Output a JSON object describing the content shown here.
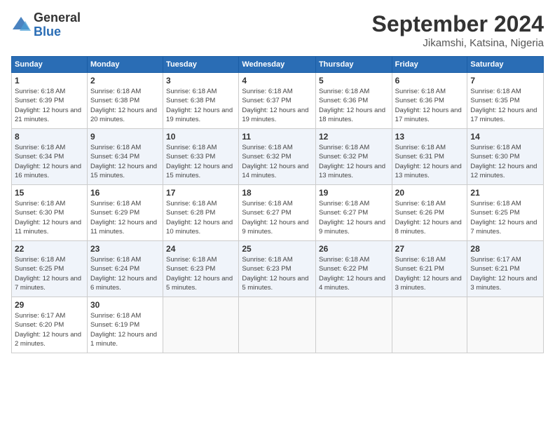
{
  "logo": {
    "general": "General",
    "blue": "Blue"
  },
  "title": "September 2024",
  "location": "Jikamshi, Katsina, Nigeria",
  "headers": [
    "Sunday",
    "Monday",
    "Tuesday",
    "Wednesday",
    "Thursday",
    "Friday",
    "Saturday"
  ],
  "weeks": [
    [
      {
        "day": "1",
        "sunrise": "6:18 AM",
        "sunset": "6:39 PM",
        "daylight": "12 hours and 21 minutes."
      },
      {
        "day": "2",
        "sunrise": "6:18 AM",
        "sunset": "6:38 PM",
        "daylight": "12 hours and 20 minutes."
      },
      {
        "day": "3",
        "sunrise": "6:18 AM",
        "sunset": "6:38 PM",
        "daylight": "12 hours and 19 minutes."
      },
      {
        "day": "4",
        "sunrise": "6:18 AM",
        "sunset": "6:37 PM",
        "daylight": "12 hours and 19 minutes."
      },
      {
        "day": "5",
        "sunrise": "6:18 AM",
        "sunset": "6:36 PM",
        "daylight": "12 hours and 18 minutes."
      },
      {
        "day": "6",
        "sunrise": "6:18 AM",
        "sunset": "6:36 PM",
        "daylight": "12 hours and 17 minutes."
      },
      {
        "day": "7",
        "sunrise": "6:18 AM",
        "sunset": "6:35 PM",
        "daylight": "12 hours and 17 minutes."
      }
    ],
    [
      {
        "day": "8",
        "sunrise": "6:18 AM",
        "sunset": "6:34 PM",
        "daylight": "12 hours and 16 minutes."
      },
      {
        "day": "9",
        "sunrise": "6:18 AM",
        "sunset": "6:34 PM",
        "daylight": "12 hours and 15 minutes."
      },
      {
        "day": "10",
        "sunrise": "6:18 AM",
        "sunset": "6:33 PM",
        "daylight": "12 hours and 15 minutes."
      },
      {
        "day": "11",
        "sunrise": "6:18 AM",
        "sunset": "6:32 PM",
        "daylight": "12 hours and 14 minutes."
      },
      {
        "day": "12",
        "sunrise": "6:18 AM",
        "sunset": "6:32 PM",
        "daylight": "12 hours and 13 minutes."
      },
      {
        "day": "13",
        "sunrise": "6:18 AM",
        "sunset": "6:31 PM",
        "daylight": "12 hours and 13 minutes."
      },
      {
        "day": "14",
        "sunrise": "6:18 AM",
        "sunset": "6:30 PM",
        "daylight": "12 hours and 12 minutes."
      }
    ],
    [
      {
        "day": "15",
        "sunrise": "6:18 AM",
        "sunset": "6:30 PM",
        "daylight": "12 hours and 11 minutes."
      },
      {
        "day": "16",
        "sunrise": "6:18 AM",
        "sunset": "6:29 PM",
        "daylight": "12 hours and 11 minutes."
      },
      {
        "day": "17",
        "sunrise": "6:18 AM",
        "sunset": "6:28 PM",
        "daylight": "12 hours and 10 minutes."
      },
      {
        "day": "18",
        "sunrise": "6:18 AM",
        "sunset": "6:27 PM",
        "daylight": "12 hours and 9 minutes."
      },
      {
        "day": "19",
        "sunrise": "6:18 AM",
        "sunset": "6:27 PM",
        "daylight": "12 hours and 9 minutes."
      },
      {
        "day": "20",
        "sunrise": "6:18 AM",
        "sunset": "6:26 PM",
        "daylight": "12 hours and 8 minutes."
      },
      {
        "day": "21",
        "sunrise": "6:18 AM",
        "sunset": "6:25 PM",
        "daylight": "12 hours and 7 minutes."
      }
    ],
    [
      {
        "day": "22",
        "sunrise": "6:18 AM",
        "sunset": "6:25 PM",
        "daylight": "12 hours and 7 minutes."
      },
      {
        "day": "23",
        "sunrise": "6:18 AM",
        "sunset": "6:24 PM",
        "daylight": "12 hours and 6 minutes."
      },
      {
        "day": "24",
        "sunrise": "6:18 AM",
        "sunset": "6:23 PM",
        "daylight": "12 hours and 5 minutes."
      },
      {
        "day": "25",
        "sunrise": "6:18 AM",
        "sunset": "6:23 PM",
        "daylight": "12 hours and 5 minutes."
      },
      {
        "day": "26",
        "sunrise": "6:18 AM",
        "sunset": "6:22 PM",
        "daylight": "12 hours and 4 minutes."
      },
      {
        "day": "27",
        "sunrise": "6:18 AM",
        "sunset": "6:21 PM",
        "daylight": "12 hours and 3 minutes."
      },
      {
        "day": "28",
        "sunrise": "6:17 AM",
        "sunset": "6:21 PM",
        "daylight": "12 hours and 3 minutes."
      }
    ],
    [
      {
        "day": "29",
        "sunrise": "6:17 AM",
        "sunset": "6:20 PM",
        "daylight": "12 hours and 2 minutes."
      },
      {
        "day": "30",
        "sunrise": "6:18 AM",
        "sunset": "6:19 PM",
        "daylight": "12 hours and 1 minute."
      },
      null,
      null,
      null,
      null,
      null
    ]
  ],
  "labels": {
    "sunrise": "Sunrise:",
    "sunset": "Sunset:",
    "daylight": "Daylight:"
  }
}
